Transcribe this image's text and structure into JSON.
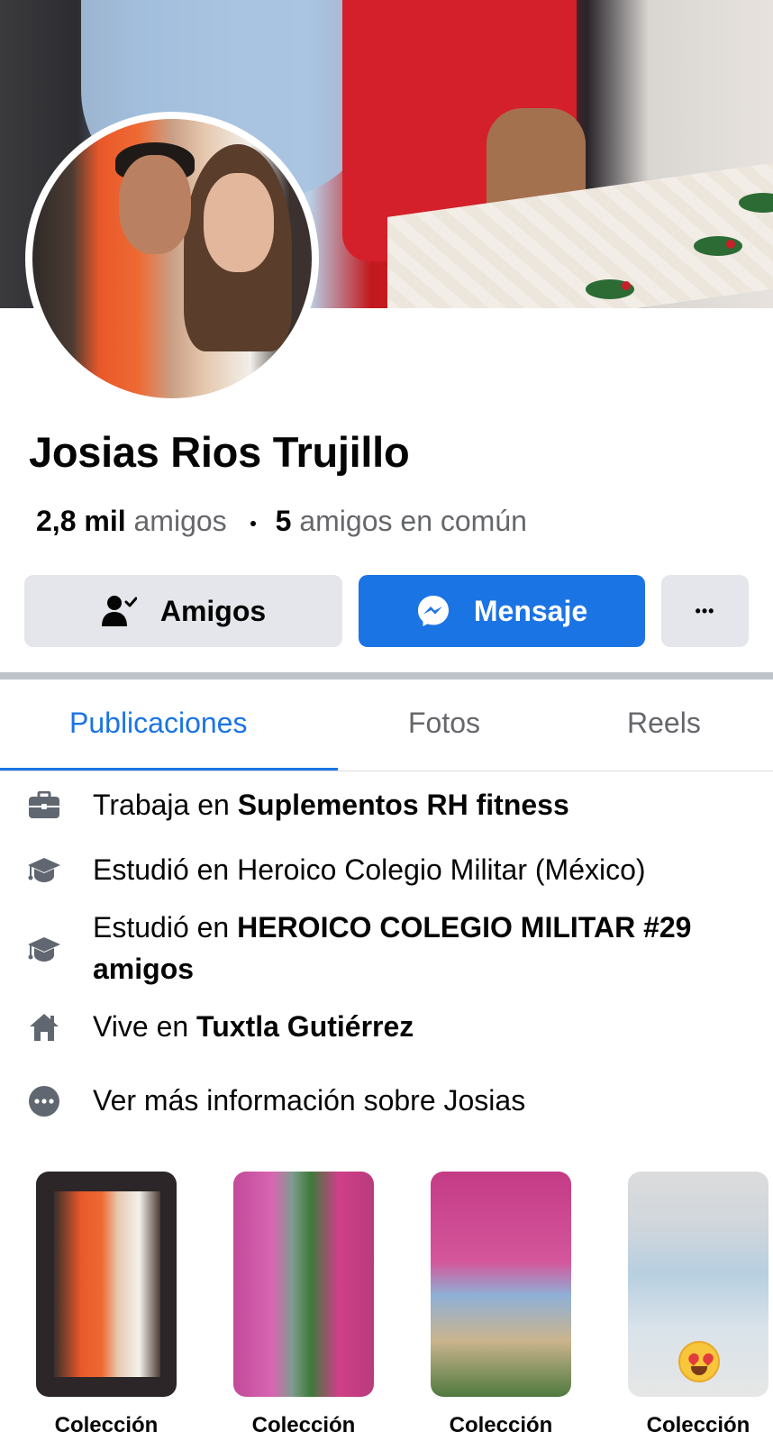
{
  "profile": {
    "name": "Josias Rios Trujillo",
    "friends_count": "2,8 mil",
    "friends_label": "amigos",
    "mutual_count": "5",
    "mutual_label": "amigos en común"
  },
  "actions": {
    "friends_label": "Amigos",
    "message_label": "Mensaje",
    "more_label": "•••"
  },
  "tabs": [
    {
      "label": "Publicaciones",
      "active": true
    },
    {
      "label": "Fotos",
      "active": false
    },
    {
      "label": "Reels",
      "active": false
    }
  ],
  "details": [
    {
      "icon": "briefcase-icon",
      "prefix": "Trabaja en ",
      "bold": "Suplementos RH fitness"
    },
    {
      "icon": "graduation-cap-icon",
      "prefix": "Estudió en Heroico Colegio Militar (México)",
      "bold": ""
    },
    {
      "icon": "graduation-cap-icon",
      "prefix": "Estudió en ",
      "bold": "HEROICO COLEGIO MILITAR #29 amigos"
    },
    {
      "icon": "home-icon",
      "prefix": "Vive en ",
      "bold": "Tuxtla Gutiérrez"
    },
    {
      "icon": "more-info-icon",
      "prefix": "Ver más información sobre Josias",
      "bold": ""
    }
  ],
  "collections": [
    {
      "label": "Colección"
    },
    {
      "label": "Colección"
    },
    {
      "label": "Colección"
    },
    {
      "label": "Colección"
    }
  ],
  "colors": {
    "accent": "#1b74e4",
    "secondary_button": "#e4e6eb",
    "muted_text": "#65676b",
    "icon_gray": "#606770"
  }
}
